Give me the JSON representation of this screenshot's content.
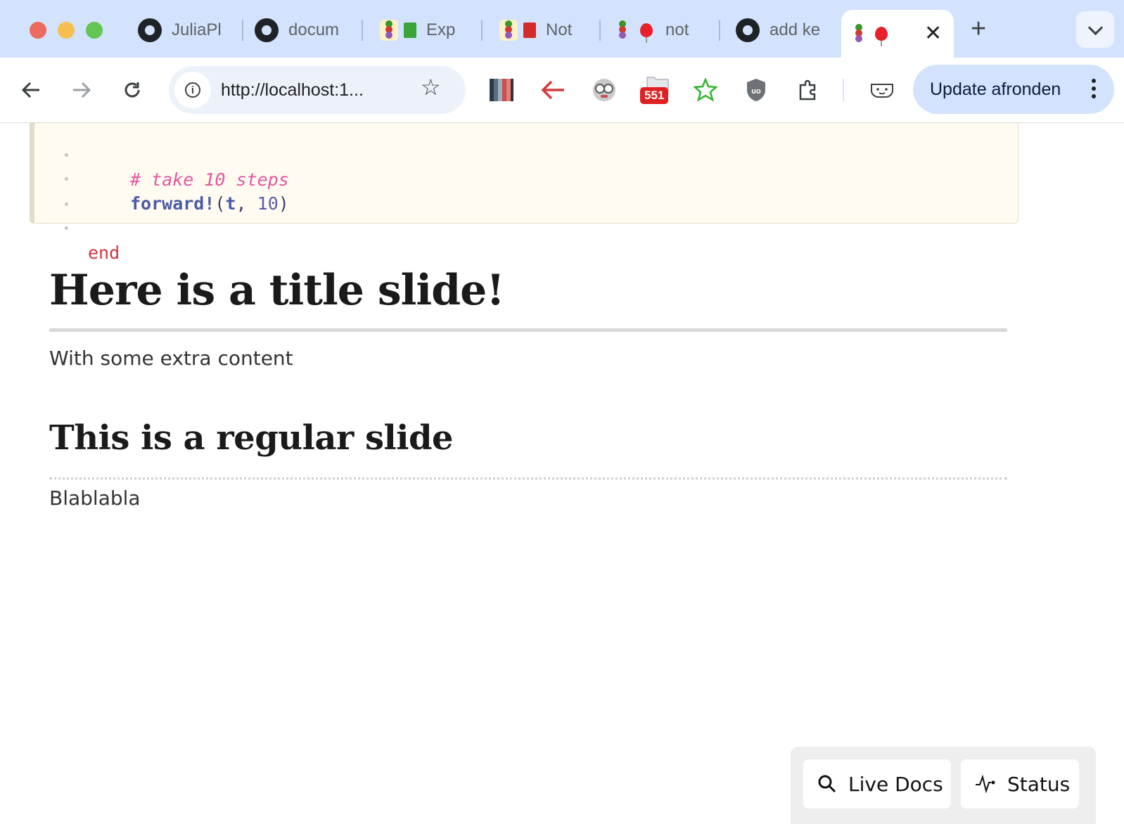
{
  "browser": {
    "tabs": [
      {
        "label": "JuliaPl",
        "icon": "github-icon"
      },
      {
        "label": "docum",
        "icon": "github-icon"
      },
      {
        "label": "Exp",
        "icon": "pluto-book-green-icon"
      },
      {
        "label": "Not",
        "icon": "pluto-book-red-icon"
      },
      {
        "label": "not",
        "icon": "pluto-balloon-icon"
      },
      {
        "label": "add ke",
        "icon": "github-icon"
      },
      {
        "label": "",
        "icon": "pluto-balloon-icon",
        "active": true
      }
    ],
    "url": "http://localhost:1...",
    "extension_badge": "551",
    "update_button_label": "Update afronden"
  },
  "notebook": {
    "code_lines": [
      {
        "comment": "# take 10 steps"
      },
      {
        "fn": "forward!",
        "open": "(",
        "arg": "t",
        "sep": ", ",
        "num": "10",
        "close": ")"
      },
      {},
      {
        "keyword": "end"
      }
    ],
    "title_slide": {
      "heading": "Here is a title slide!",
      "text": "With some extra content"
    },
    "regular_slide": {
      "heading": "This is a regular slide",
      "text": "Blablabla"
    }
  },
  "footer": {
    "live_docs_label": "Live Docs",
    "status_label": "Status"
  },
  "colors": {
    "tab_strip": "#d3e3fd",
    "code_background": "#fffbf1",
    "comment": "#e4579f",
    "keyword": "#d3353f"
  }
}
